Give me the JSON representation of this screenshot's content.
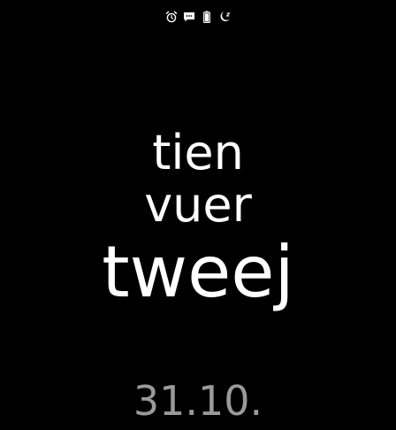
{
  "status_bar": {
    "icons": [
      "alarm-icon",
      "message-icon",
      "battery-icon",
      "sleep-moon-icon"
    ]
  },
  "clock": {
    "line1": "tien",
    "line2": "vuer",
    "line3": "tweej"
  },
  "date": "31.10.",
  "colors": {
    "background": "#000000",
    "text": "#ffffff",
    "date_text": "#9a9a9a",
    "icon": "#ffffff"
  }
}
